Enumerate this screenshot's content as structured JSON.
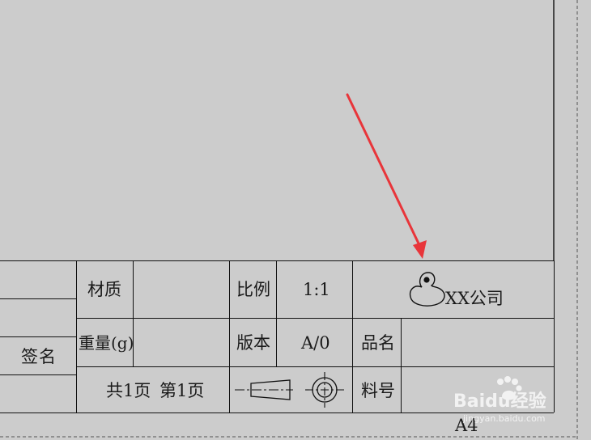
{
  "title_block": {
    "signature_label": "签名",
    "material_label": "材质",
    "weight_label": "重量(g)",
    "sheet_count": "共1页 第1页",
    "scale_label": "比例",
    "scale_value": "1:1",
    "version_label": "版本",
    "version_value": "A/0",
    "company_name": "XX公司",
    "part_name_label": "品名",
    "part_number_label": "料号",
    "paper_size": "A4"
  },
  "annotation": {
    "arrow_color": "#e8353a"
  },
  "watermark": {
    "brand": "Baidu经验",
    "url": "jingyan.baidu.com"
  }
}
